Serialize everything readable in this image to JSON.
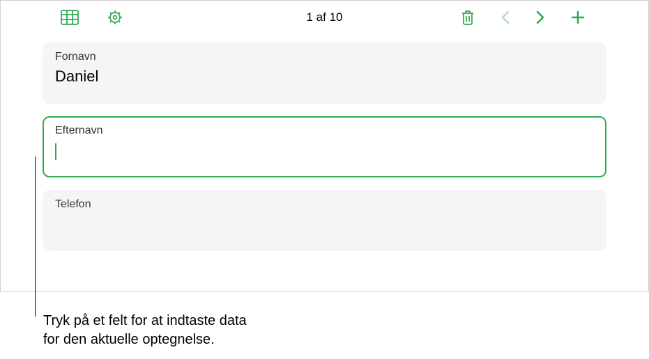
{
  "toolbar": {
    "pagination": "1 af 10"
  },
  "fields": {
    "fornavn": {
      "label": "Fornavn",
      "value": "Daniel"
    },
    "efternavn": {
      "label": "Efternavn",
      "value": ""
    },
    "telefon": {
      "label": "Telefon",
      "value": ""
    }
  },
  "callout": {
    "line1": "Tryk på et felt for at indtaste data",
    "line2": "for den aktuelle optegnelse."
  },
  "colors": {
    "accent": "#34a853",
    "field_bg": "#f5f5f5"
  }
}
